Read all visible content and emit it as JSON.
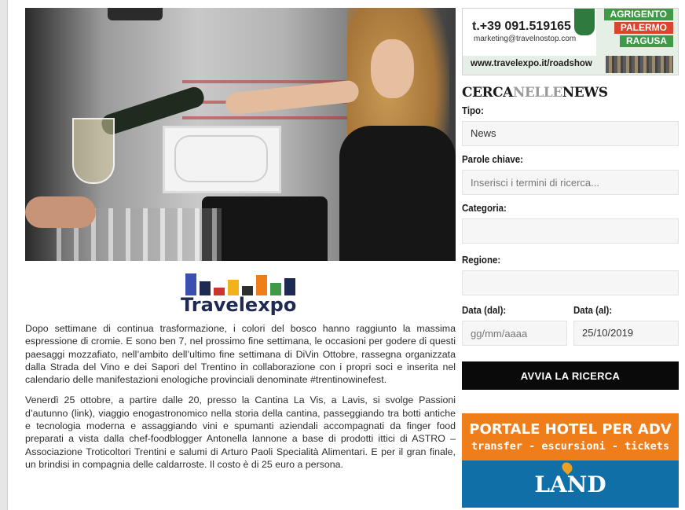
{
  "article": {
    "logo_text": "Travelexpo",
    "paragraphs": [
      "Dopo settimane di continua trasformazione, i colori del bosco hanno raggiunto la massima espressione di cromie. E sono ben 7, nel prossimo fine settimana, le occasioni per godere di questi paesaggi mozzafiato, nell’ambito dell’ultimo fine settimana di DiVin Ottobre, rassegna organizzata dalla Strada del Vino e dei Sapori del Trentino in collaborazione con i propri soci e inserita nel calendario delle manifestazioni enologiche provinciali denominate #trentinowinefest.",
      "Venerdì 25 ottobre, a partire dalle 20, presso la Cantina La Vis, a Lavis, si svolge Passioni d’autunno (link), viaggio enogastronomico nella storia della cantina, passeggiando tra botti antiche e tecnologia moderna e assaggiando vini e spumanti aziendali accompagnati da finger food preparati a vista dalla chef-foodblogger Antonella Iannone a base di prodotti ittici di ASTRO – Associazione Troticoltori Trentini e salumi di Arturo Paoli Specialità Alimentari. E per il gran finale, un brindisi in compagnia delle caldarroste. Il costo è di 25 euro a persona."
    ]
  },
  "sidebar": {
    "ad_top": {
      "phone": "t.+39 091.519165",
      "email": "marketing@travelnostop.com",
      "cities": [
        "AGRIGENTO",
        "PALERMO",
        "RAGUSA"
      ],
      "url": "www.travelexpo.it/roadshow"
    },
    "search": {
      "title_part1": "CERCA",
      "title_part2": "NELLE",
      "title_part3": "NEWS",
      "tipo_label": "Tipo:",
      "tipo_value": "News",
      "keywords_label": "Parole chiave:",
      "keywords_placeholder": "Inserisci i termini di ricerca...",
      "category_label": "Categoria:",
      "category_value": "",
      "region_label": "Regione:",
      "region_value": "",
      "date_from_label": "Data (dal):",
      "date_from_placeholder": "gg/mm/aaaa",
      "date_to_label": "Data (al):",
      "date_to_value": "25/10/2019",
      "button_label": "AVVIA LA RICERCA"
    },
    "ad_hotel": {
      "headline": "PORTALE HOTEL PER ADV",
      "subline": "transfer - escursioni - tickets",
      "brand": "LAND"
    }
  },
  "colors": {
    "accent_orange": "#ef7e1a",
    "accent_blue": "#0f6fa6",
    "button_black": "#0a0a0a",
    "logo_navy": "#1f2a52"
  }
}
